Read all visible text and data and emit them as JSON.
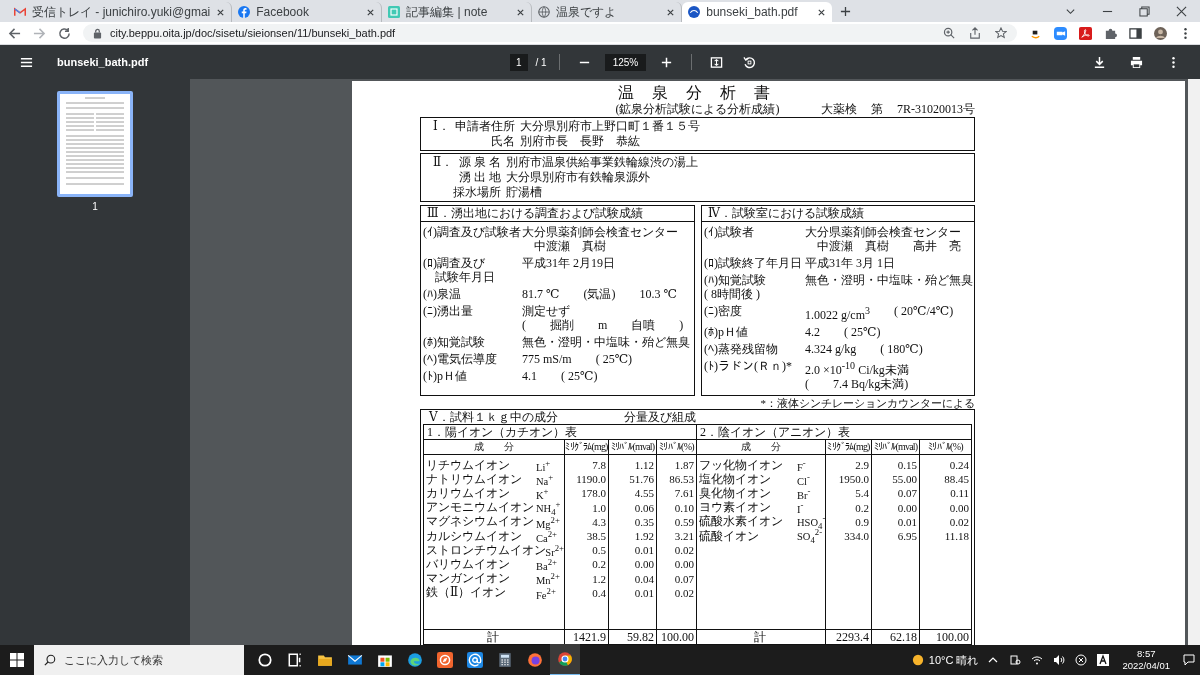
{
  "browser": {
    "tabs": [
      {
        "kind": "gmail",
        "title": "受信トレイ - junichiro.yuki@gmai",
        "selected": false
      },
      {
        "kind": "facebook",
        "title": "Facebook",
        "selected": false
      },
      {
        "kind": "note",
        "title": "記事編集 | note",
        "selected": false
      },
      {
        "kind": "globe",
        "title": "温泉ですよ",
        "selected": false
      },
      {
        "kind": "pdf",
        "title": "bunseki_bath.pdf",
        "selected": true
      }
    ],
    "url": "city.beppu.oita.jp/doc/sisetu/sieionsen/11/bunseki_bath.pdf"
  },
  "viewer": {
    "file_name": "bunseki_bath.pdf",
    "page": "1",
    "page_total": "/ 1",
    "zoom": "125%",
    "thumbnails": [
      {
        "label": "1",
        "selected": true
      }
    ]
  },
  "document": {
    "title": "温 泉 分 析 書",
    "subtitle": "(鉱泉分析試験による分析成績)",
    "reference": [
      "大薬検",
      "第",
      "7R-31020013号"
    ],
    "section_1": {
      "number": "Ⅰ．",
      "rows": [
        {
          "label": "申請者住所",
          "value": "大分県別府市上野口町１番１５号"
        },
        {
          "label": "氏名",
          "value": "別府市長　長野　恭紘"
        }
      ]
    },
    "section_2": {
      "number": "Ⅱ．",
      "rows": [
        {
          "label": "源 泉 名",
          "value": "別府市温泉供給事業鉄輪線渋の湯上"
        },
        {
          "label": "湧 出 地",
          "value": "大分県別府市有鉄輪泉源外"
        },
        {
          "label": "採水場所",
          "value": "貯湯槽"
        }
      ]
    },
    "section_3": {
      "title": "Ⅲ．湧出地における調査および試験成績",
      "items": [
        {
          "label": [
            "(ｲ)調査及び試験者"
          ],
          "lines": [
            [
              "大分県薬剤師会検査センター"
            ],
            [
              "　中渡瀬　真樹"
            ]
          ]
        },
        {
          "label": [
            "(ﾛ)調査及び",
            "　試験年月日"
          ],
          "lines": [
            [
              "平成31年 2月19日"
            ]
          ]
        },
        {
          "label": [
            "(ﾊ)泉温"
          ],
          "lines": [
            [
              "81.7 ℃",
              "(気温)",
              "10.3 ℃"
            ]
          ]
        },
        {
          "label": [
            "(ﾆ)湧出量"
          ],
          "lines": [
            [
              "測定せず"
            ],
            [
              "(",
              "掘削",
              "m",
              "自噴",
              ")"
            ]
          ]
        },
        {
          "label": [
            "(ﾎ)知覚試験"
          ],
          "lines": [
            [
              "無色・澄明・中塩味・殆ど無臭"
            ]
          ]
        },
        {
          "label": [
            "(ﾍ)電気伝導度"
          ],
          "lines": [
            [
              "775 mS/m",
              "( 25℃)"
            ]
          ]
        },
        {
          "label": [
            "(ﾄ)pＨ値"
          ],
          "lines": [
            [
              "4.1",
              "( 25℃)"
            ]
          ]
        }
      ]
    },
    "section_4": {
      "title": "Ⅳ．試験室における試験成績",
      "items": [
        {
          "label": [
            "(ｲ)試験者"
          ],
          "lines": [
            [
              "大分県薬剤師会検査センター"
            ],
            [
              "　中渡瀬　真樹",
              "高井　亮"
            ]
          ]
        },
        {
          "label": [
            "(ﾛ)試験終了年月日"
          ],
          "lines": [
            [
              "平成31年 3月 1日"
            ]
          ]
        },
        {
          "label": [
            "(ﾊ)知覚試験",
            "( 8時間後 )"
          ],
          "lines": [
            [
              "無色・澄明・中塩味・殆ど無臭"
            ]
          ]
        },
        {
          "label": [
            "(ﾆ)密度"
          ],
          "lines": [
            [
              "1.0022 g/cm$^{3}$",
              "( 20℃/4℃)"
            ]
          ]
        },
        {
          "label": [
            "(ﾎ)pＨ値"
          ],
          "lines": [
            [
              "4.2",
              "( 25℃)"
            ]
          ]
        },
        {
          "label": [
            "(ﾍ)蒸発残留物"
          ],
          "lines": [
            [
              "4.324 g/kg",
              "( 180℃)"
            ]
          ]
        },
        {
          "label": [
            "(ﾄ)ラドン(Ｒｎ)*"
          ],
          "lines": [
            [
              "2.0 ×10$^{-10}$ Ci/kg未満"
            ],
            [
              "(",
              "7.4 Bq/kg未満)"
            ]
          ]
        }
      ],
      "note": "*：液体シンチレーションカウンターによる"
    },
    "section_5": {
      "title": "Ⅴ．試料１ｋｇ中の成分",
      "subtitle": "分量及び組成",
      "tables": [
        {
          "title": "1．陽イオン（カチオン）表",
          "columns": [
            "成　　分",
            "ﾐﾘｸﾞﾗﾑ(mg)",
            "ﾐﾘﾊﾞﾙ(mval)",
            "ﾐﾘﾊﾞﾙ(%)"
          ],
          "rows": [
            {
              "name": "リチウムイオン",
              "formula": "Li$^{+}$",
              "values": [
                "7.8",
                "1.12",
                "1.87"
              ]
            },
            {
              "name": "ナトリウムイオン",
              "formula": "Na$^{+}$",
              "values": [
                "1190.0",
                "51.76",
                "86.53"
              ]
            },
            {
              "name": "カリウムイオン",
              "formula": "K$^{+}$",
              "values": [
                "178.0",
                "4.55",
                "7.61"
              ]
            },
            {
              "name": "アンモニウムイオン",
              "formula": "NH$_{4}$$^{+}$",
              "values": [
                "1.0",
                "0.06",
                "0.10"
              ]
            },
            {
              "name": "マグネシウムイオン",
              "formula": "Mg$^{2+}$",
              "values": [
                "4.3",
                "0.35",
                "0.59"
              ]
            },
            {
              "name": "カルシウムイオン",
              "formula": "Ca$^{2+}$",
              "values": [
                "38.5",
                "1.92",
                "3.21"
              ]
            },
            {
              "name": "ストロンチウムイオン",
              "formula": "Sr$^{2+}$",
              "values": [
                "0.5",
                "0.01",
                "0.02"
              ]
            },
            {
              "name": "バリウムイオン",
              "formula": "Ba$^{2+}$",
              "values": [
                "0.2",
                "0.00",
                "0.00"
              ]
            },
            {
              "name": "マンガンイオン",
              "formula": "Mn$^{2+}$",
              "values": [
                "1.2",
                "0.04",
                "0.07"
              ]
            },
            {
              "name": "鉄（Ⅱ）イオン",
              "formula": "Fe$^{2+}$",
              "values": [
                "0.4",
                "0.01",
                "0.02"
              ]
            }
          ],
          "total": [
            "計",
            "1421.9",
            "59.82",
            "100.00"
          ]
        },
        {
          "title": "2．陰イオン（アニオン）表",
          "columns": [
            "成　　分",
            "ﾐﾘｸﾞﾗﾑ(mg)",
            "ﾐﾘﾊﾞﾙ(mval)",
            "ﾐﾘﾊﾞﾙ(%)"
          ],
          "rows": [
            {
              "name": "フッ化物イオン",
              "formula": "F$^{-}$",
              "values": [
                "2.9",
                "0.15",
                "0.24"
              ]
            },
            {
              "name": "塩化物イオン",
              "formula": "Cl$^{-}$",
              "values": [
                "1950.0",
                "55.00",
                "88.45"
              ]
            },
            {
              "name": "臭化物イオン",
              "formula": "Br$^{-}$",
              "values": [
                "5.4",
                "0.07",
                "0.11"
              ]
            },
            {
              "name": "ヨウ素イオン",
              "formula": "I$^{-}$",
              "values": [
                "0.2",
                "0.00",
                "0.00"
              ]
            },
            {
              "name": "硫酸水素イオン",
              "formula": "HSO$_{4}$$^{-}$",
              "values": [
                "0.9",
                "0.01",
                "0.02"
              ]
            },
            {
              "name": "硫酸イオン",
              "formula": "SO$_{4}$$^{2-}$",
              "values": [
                "334.0",
                "6.95",
                "11.18"
              ]
            }
          ],
          "total": [
            "計",
            "2293.4",
            "62.18",
            "100.00"
          ]
        }
      ]
    }
  },
  "taskbar": {
    "search_placeholder": "ここに入力して検索",
    "weather": "10°C 晴れ",
    "time": "8:57",
    "date": "2022/04/01"
  }
}
